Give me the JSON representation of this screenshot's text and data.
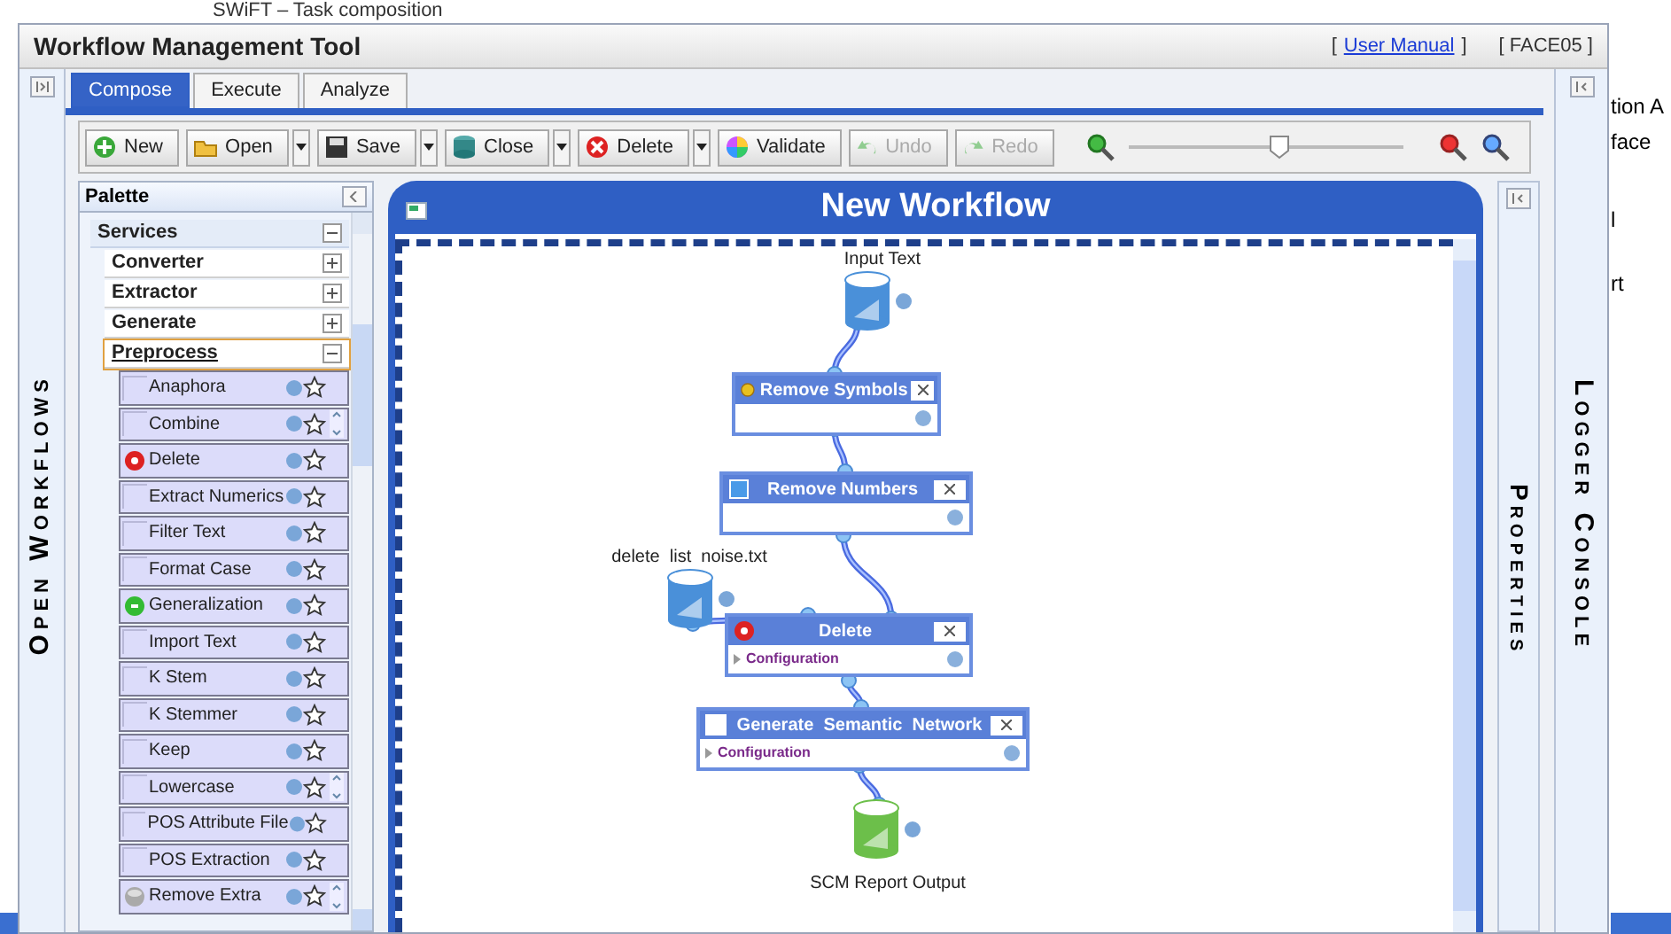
{
  "background": {
    "heading": "SWiFT – Task composition",
    "side_texts": [
      "tion A",
      "face",
      "l",
      "rt"
    ]
  },
  "window": {
    "title": "Workflow Management Tool",
    "link_open": "[",
    "link": "User Manual",
    "link_close": "]",
    "instance": "[ FACE05 ]"
  },
  "left_panel": {
    "title": "Open Workflows"
  },
  "tabs": [
    {
      "label": "Compose",
      "selected": true
    },
    {
      "label": "Execute",
      "selected": false
    },
    {
      "label": "Analyze",
      "selected": false
    }
  ],
  "toolbar": {
    "buttons": [
      {
        "kind": "new",
        "label": "New",
        "disabled": false,
        "dropdown": false
      },
      {
        "kind": "open",
        "label": "Open",
        "disabled": false,
        "dropdown": true
      },
      {
        "kind": "save",
        "label": "Save",
        "disabled": false,
        "dropdown": true
      },
      {
        "kind": "close",
        "label": "Close",
        "disabled": false,
        "dropdown": true
      },
      {
        "kind": "delete",
        "label": "Delete",
        "disabled": false,
        "dropdown": true
      },
      {
        "kind": "validate",
        "label": "Validate",
        "disabled": false,
        "dropdown": false
      },
      {
        "kind": "undo",
        "label": "Undo",
        "disabled": true,
        "dropdown": false
      },
      {
        "kind": "redo",
        "label": "Redo",
        "disabled": true,
        "dropdown": false
      }
    ],
    "zoom": {
      "level": 0.55
    }
  },
  "palette": {
    "title": "Palette",
    "tree": [
      {
        "label": "Services",
        "expanded": true,
        "selected": false,
        "children": [
          {
            "label": "Converter",
            "expanded": false,
            "selected": false
          },
          {
            "label": "Extractor",
            "expanded": false,
            "selected": false
          },
          {
            "label": "Generate",
            "expanded": false,
            "selected": false
          },
          {
            "label": "Preprocess",
            "expanded": true,
            "selected": true,
            "children": [
              {
                "label": "Anaphora",
                "kind": "none",
                "spinner": false
              },
              {
                "label": "Combine",
                "kind": "none",
                "spinner": true
              },
              {
                "label": "Delete",
                "kind": "red",
                "spinner": false
              },
              {
                "label": "Extract Numerics",
                "kind": "none",
                "spinner": false
              },
              {
                "label": "Filter Text",
                "kind": "none",
                "spinner": false
              },
              {
                "label": "Format Case",
                "kind": "none",
                "spinner": false
              },
              {
                "label": "Generalization",
                "kind": "green",
                "spinner": false
              },
              {
                "label": "Import Text",
                "kind": "none",
                "spinner": false
              },
              {
                "label": "K Stem",
                "kind": "none",
                "spinner": false
              },
              {
                "label": "K Stemmer",
                "kind": "none",
                "spinner": false
              },
              {
                "label": "Keep",
                "kind": "none",
                "spinner": false
              },
              {
                "label": "Lowercase",
                "kind": "none",
                "spinner": true
              },
              {
                "label": "POS Attribute File",
                "kind": "none",
                "spinner": false
              },
              {
                "label": "POS Extraction",
                "kind": "none",
                "spinner": false
              },
              {
                "label": "Remove Extra",
                "kind": "grey",
                "spinner": true
              }
            ]
          }
        ]
      }
    ]
  },
  "canvas": {
    "title": "New Workflow",
    "nodes": [
      {
        "kind": "data",
        "label": "Input Text",
        "color": "#4a90d9"
      },
      {
        "kind": "task",
        "title": "Remove Symbols"
      },
      {
        "kind": "task",
        "title": "Remove Numbers"
      },
      {
        "kind": "data",
        "label": "delete  list  noise.txt",
        "color": "#4a90d9"
      },
      {
        "kind": "task",
        "title": "Delete",
        "config": "Configuration"
      },
      {
        "kind": "task",
        "title": "Generate  Semantic  Network",
        "config": "Configuration"
      },
      {
        "kind": "data",
        "label": "SCM Report Output",
        "color": "#6cbf4a"
      }
    ]
  },
  "properties_panel": {
    "title": "Properties"
  },
  "logger_panel": {
    "title": "Logger Console"
  }
}
